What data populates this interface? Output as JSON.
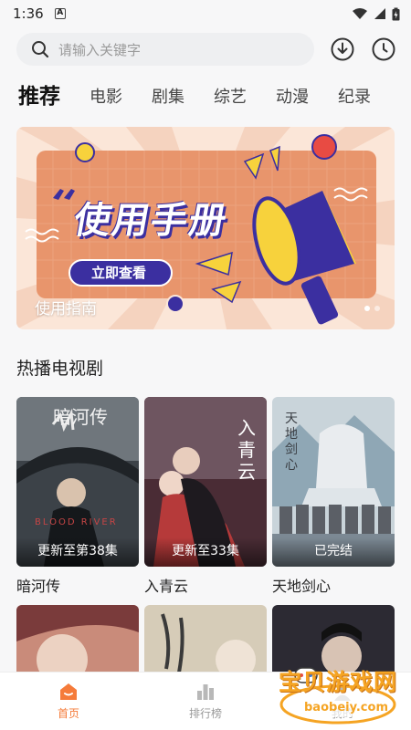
{
  "status": {
    "time": "1:36",
    "notif": "A"
  },
  "search": {
    "placeholder": "请输入关键字"
  },
  "tabs": [
    {
      "label": "推荐",
      "active": true
    },
    {
      "label": "电影"
    },
    {
      "label": "剧集"
    },
    {
      "label": "综艺"
    },
    {
      "label": "动漫"
    },
    {
      "label": "纪录"
    }
  ],
  "banner": {
    "headline": "使用手册",
    "button": "立即查看",
    "caption": "使用指南",
    "colors": {
      "bg": "#fbe6d8",
      "card": "#e8956c",
      "accent": "#3b2fa0",
      "yellow": "#f7d23c"
    }
  },
  "section": {
    "title": "热播电视剧"
  },
  "shows": [
    {
      "title": "暗河传",
      "status": "更新至第38集",
      "poster_text": "暗河传",
      "poster_sub": "BLOOD RIVER",
      "poster_color": "#3c4248"
    },
    {
      "title": "入青云",
      "status": "更新至33集",
      "poster_text": "入青云",
      "poster_color": "#b63a3a"
    },
    {
      "title": "天地剑心",
      "status": "已完结",
      "poster_text": "天地剑心",
      "poster_color": "#8fa7b5"
    }
  ],
  "row2_posters": [
    {
      "poster_color": "#c98b7a"
    },
    {
      "poster_color": "#d6ccb8"
    },
    {
      "poster_color": "#2c2a33"
    }
  ],
  "nav": [
    {
      "label": "首页",
      "icon": "home-icon",
      "active": true
    },
    {
      "label": "排行榜",
      "icon": "ranking-icon"
    },
    {
      "label": "我的",
      "icon": "profile-icon"
    }
  ],
  "watermark": {
    "text": "宝贝游戏网",
    "url": "baobeiy.com"
  }
}
